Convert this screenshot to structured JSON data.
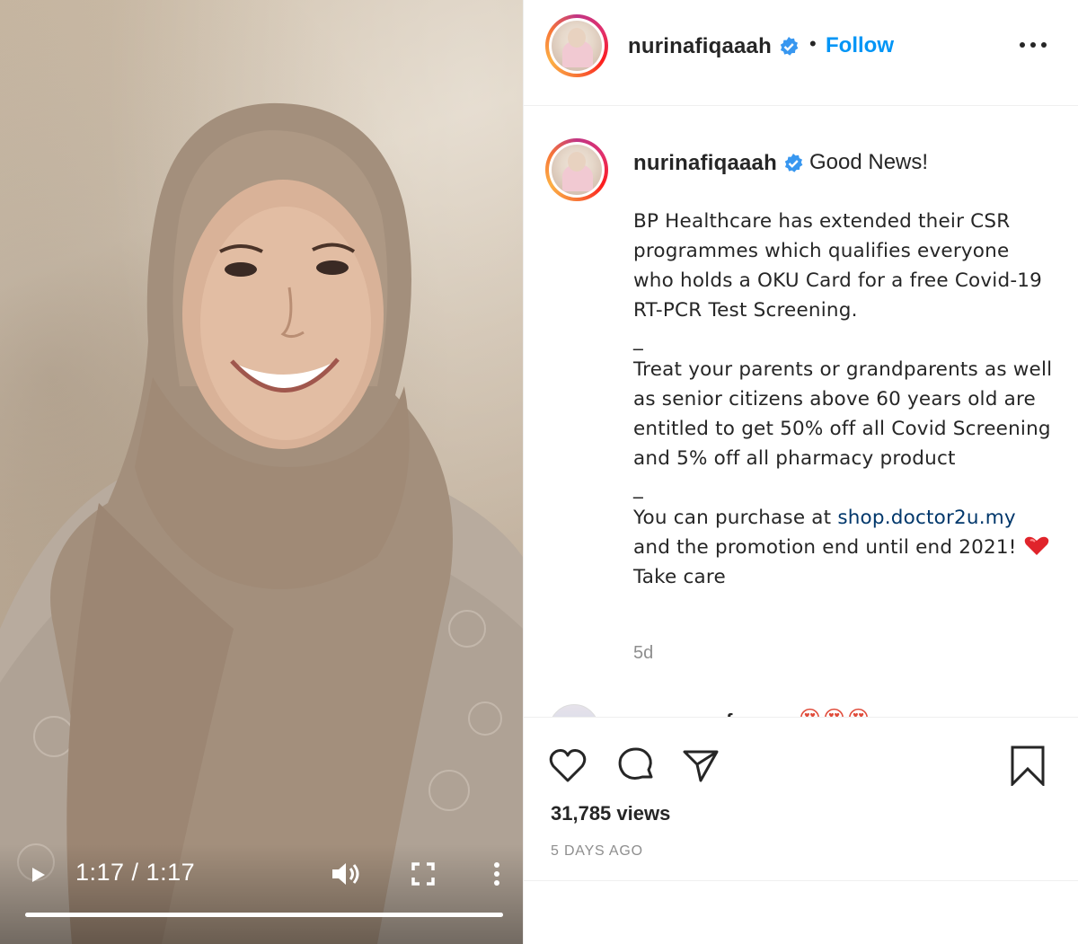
{
  "video": {
    "time_display": "1:17 / 1:17",
    "progress": 1.0
  },
  "header": {
    "username": "nurinafiqaaah",
    "separator": "•",
    "follow_label": "Follow"
  },
  "caption": {
    "username": "nurinafiqaaah",
    "first_line": "Good News!",
    "paragraphs": [
      "BP Healthcare has extended their CSR programmes which qualifies everyone who holds a OKU Card for a free Covid-19 RT-PCR Test Screening.",
      "_",
      "Treat your parents or grandparents as well as senior citizens above 60 years old are entitled to get 50% off all Covid Screening and 5% off all pharmacy product",
      "_"
    ],
    "purchase_prefix": "You can purchase at ",
    "purchase_link": "shop.doctor2u.my",
    "purchase_suffix": " and the promotion end until end 2021! ",
    "closing": " Take care",
    "time_ago": "5d"
  },
  "comment_peek": {
    "username": "mymo.perfume",
    "emojis": "😍😍😍"
  },
  "actions": {
    "views": "31,785 views",
    "posted": "5 DAYS AGO"
  },
  "colors": {
    "link_blue": "#0095f6",
    "verified_blue": "#3897f0",
    "text": "#262626",
    "muted": "#8e8e8e"
  }
}
